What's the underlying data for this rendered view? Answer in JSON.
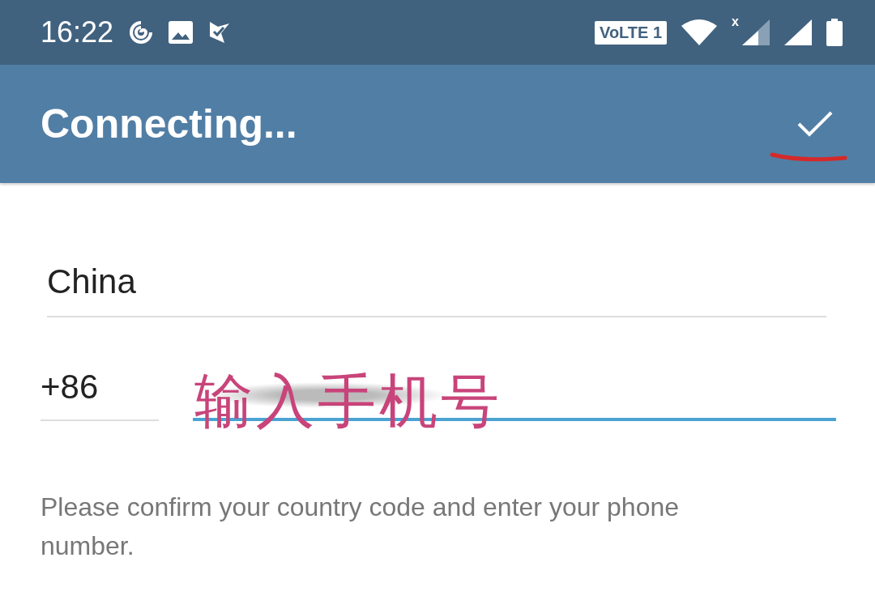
{
  "status_bar": {
    "time": "16:22",
    "volte_badge": "VoLTE 1",
    "sim_mark": "x"
  },
  "app_bar": {
    "title": "Connecting..."
  },
  "form": {
    "country": "China",
    "country_code": "+86",
    "phone_focused": true
  },
  "annotation": {
    "text": "输入手机号"
  },
  "hint": "Please confirm your country code and enter your phone number."
}
